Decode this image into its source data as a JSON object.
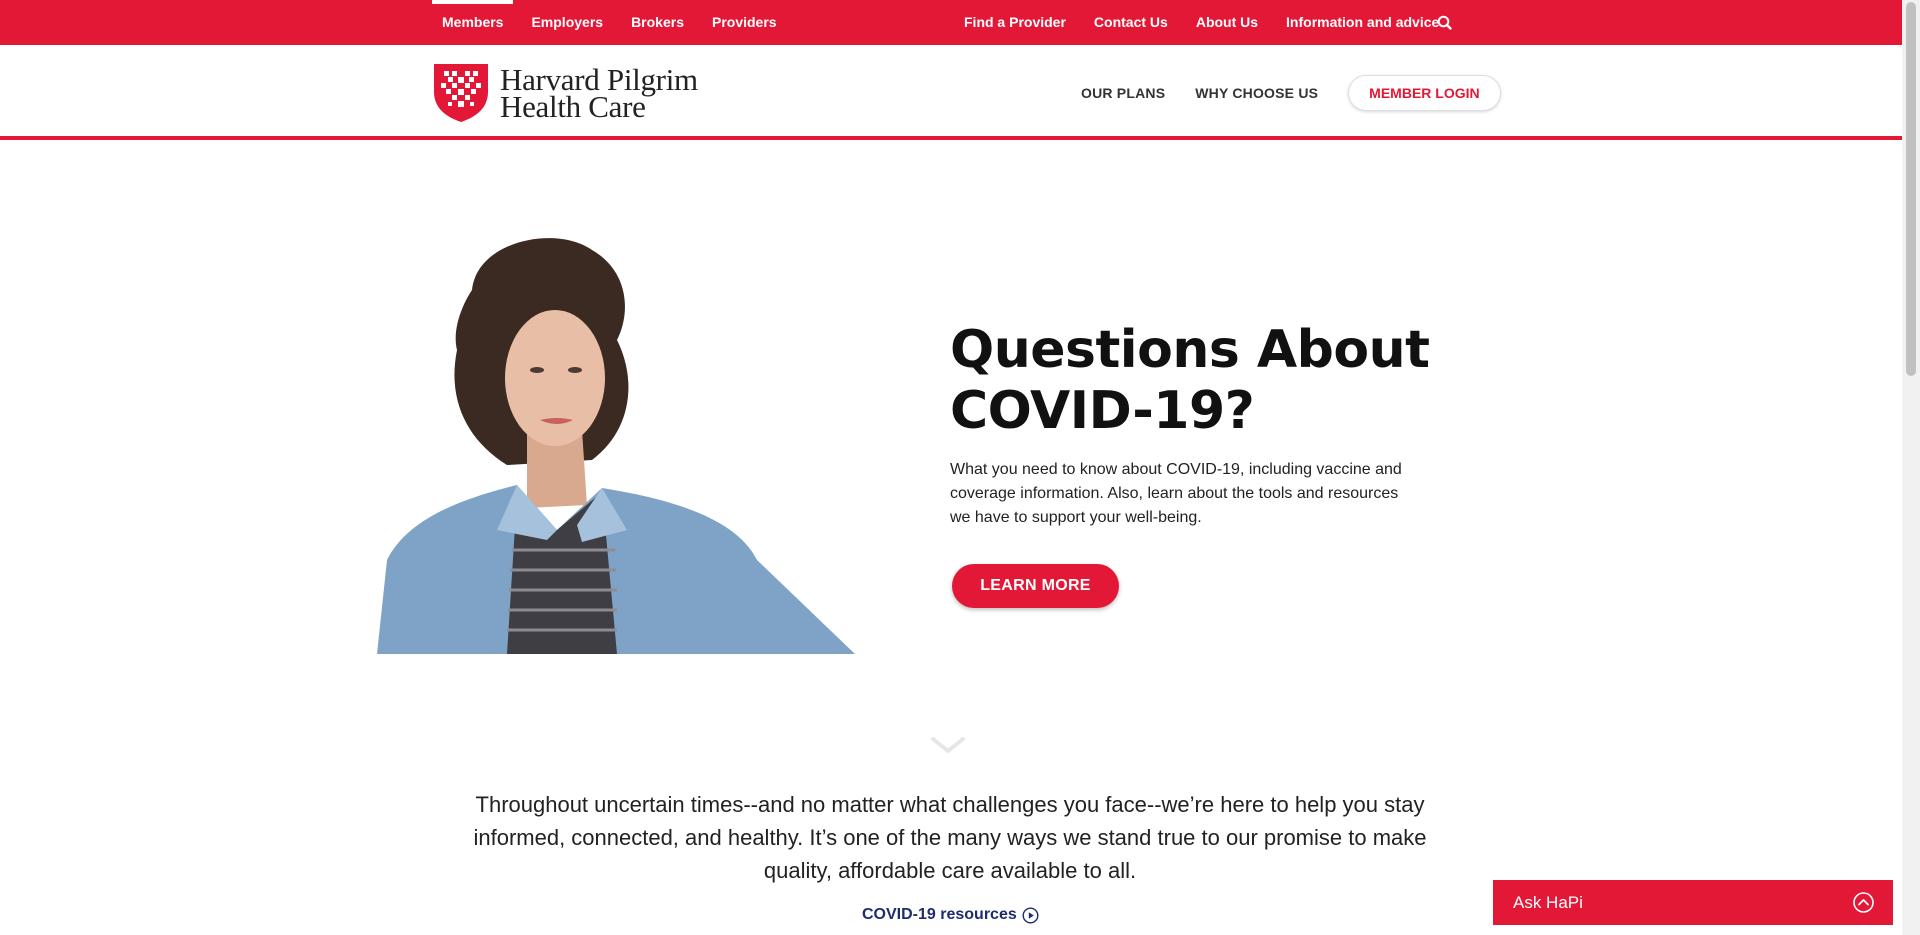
{
  "topbar": {
    "left_links": [
      {
        "label": "Members",
        "active": true
      },
      {
        "label": "Employers"
      },
      {
        "label": "Brokers"
      },
      {
        "label": "Providers"
      }
    ],
    "right_links": [
      {
        "label": "Find a Provider"
      },
      {
        "label": "Contact Us"
      },
      {
        "label": "About Us"
      },
      {
        "label": "Information and advice"
      }
    ],
    "search_icon": "search-icon"
  },
  "header": {
    "logo_line1": "Harvard Pilgrim",
    "logo_line2": "Health Care",
    "nav": [
      "OUR PLANS",
      "WHY CHOOSE US"
    ],
    "login_label": "MEMBER LOGIN"
  },
  "hero": {
    "heading_line1": "Questions About",
    "heading_line2": "COVID-19?",
    "body": "What you need to know about COVID-19, including vaccine and coverage information. Also, learn about the tools and resources we have to support your well-being.",
    "button_label": "LEARN MORE"
  },
  "section": {
    "tagline": "Throughout uncertain times--and no matter what challenges you face--we’re here to help you stay informed, connected, and healthy. It’s one of the many ways we stand true to our promise to make quality, affordable care available to all.",
    "link_label": "COVID-19 resources"
  },
  "chat": {
    "label": "Ask HaPi"
  },
  "colors": {
    "brand_red": "#e31837",
    "link_navy": "#1d2d6e"
  }
}
